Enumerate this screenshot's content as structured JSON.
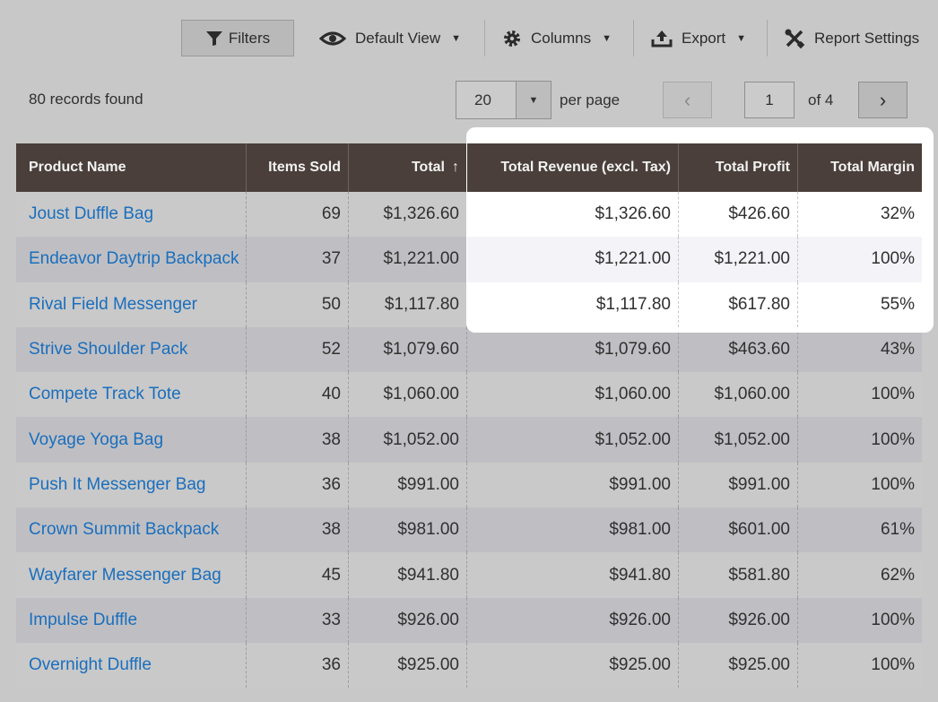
{
  "toolbar": {
    "filters_label": "Filters",
    "view_label": "Default View",
    "columns_label": "Columns",
    "export_label": "Export",
    "report_settings_label": "Report Settings"
  },
  "summary": {
    "records_found": "80 records found"
  },
  "pagination": {
    "per_page_value": "20",
    "per_page_label": "per page",
    "current_page": "1",
    "of_pages": "of 4"
  },
  "table": {
    "headers": [
      "Product Name",
      "Items Sold",
      "Total",
      "Total Revenue (excl. Tax)",
      "Total Profit",
      "Total Margin"
    ],
    "sorted_column": "Total",
    "rows": [
      [
        "Joust Duffle Bag",
        "69",
        "$1,326.60",
        "$1,326.60",
        "$426.60",
        "32%"
      ],
      [
        "Endeavor Daytrip Backpack",
        "37",
        "$1,221.00",
        "$1,221.00",
        "$1,221.00",
        "100%"
      ],
      [
        "Rival Field Messenger",
        "50",
        "$1,117.80",
        "$1,117.80",
        "$617.80",
        "55%"
      ],
      [
        "Strive Shoulder Pack",
        "52",
        "$1,079.60",
        "$1,079.60",
        "$463.60",
        "43%"
      ],
      [
        "Compete Track Tote",
        "40",
        "$1,060.00",
        "$1,060.00",
        "$1,060.00",
        "100%"
      ],
      [
        "Voyage Yoga Bag",
        "38",
        "$1,052.00",
        "$1,052.00",
        "$1,052.00",
        "100%"
      ],
      [
        "Push It Messenger Bag",
        "36",
        "$991.00",
        "$991.00",
        "$991.00",
        "100%"
      ],
      [
        "Crown Summit Backpack",
        "38",
        "$981.00",
        "$981.00",
        "$601.00",
        "61%"
      ],
      [
        "Wayfarer Messenger Bag",
        "45",
        "$941.80",
        "$941.80",
        "$581.80",
        "62%"
      ],
      [
        "Impulse Duffle",
        "33",
        "$926.00",
        "$926.00",
        "$926.00",
        "100%"
      ],
      [
        "Overnight Duffle",
        "36",
        "$925.00",
        "$925.00",
        "$925.00",
        "100%"
      ]
    ]
  },
  "colors": {
    "header_bg": "#4a3f3a",
    "link": "#1a6ebd",
    "page_bg": "#c8c8c8",
    "highlight_bg": "#ffffff"
  },
  "icons": {
    "filters": "funnel-icon",
    "view": "eye-icon",
    "columns": "gear-icon",
    "export": "upload-icon",
    "report_settings": "tools-icon"
  }
}
